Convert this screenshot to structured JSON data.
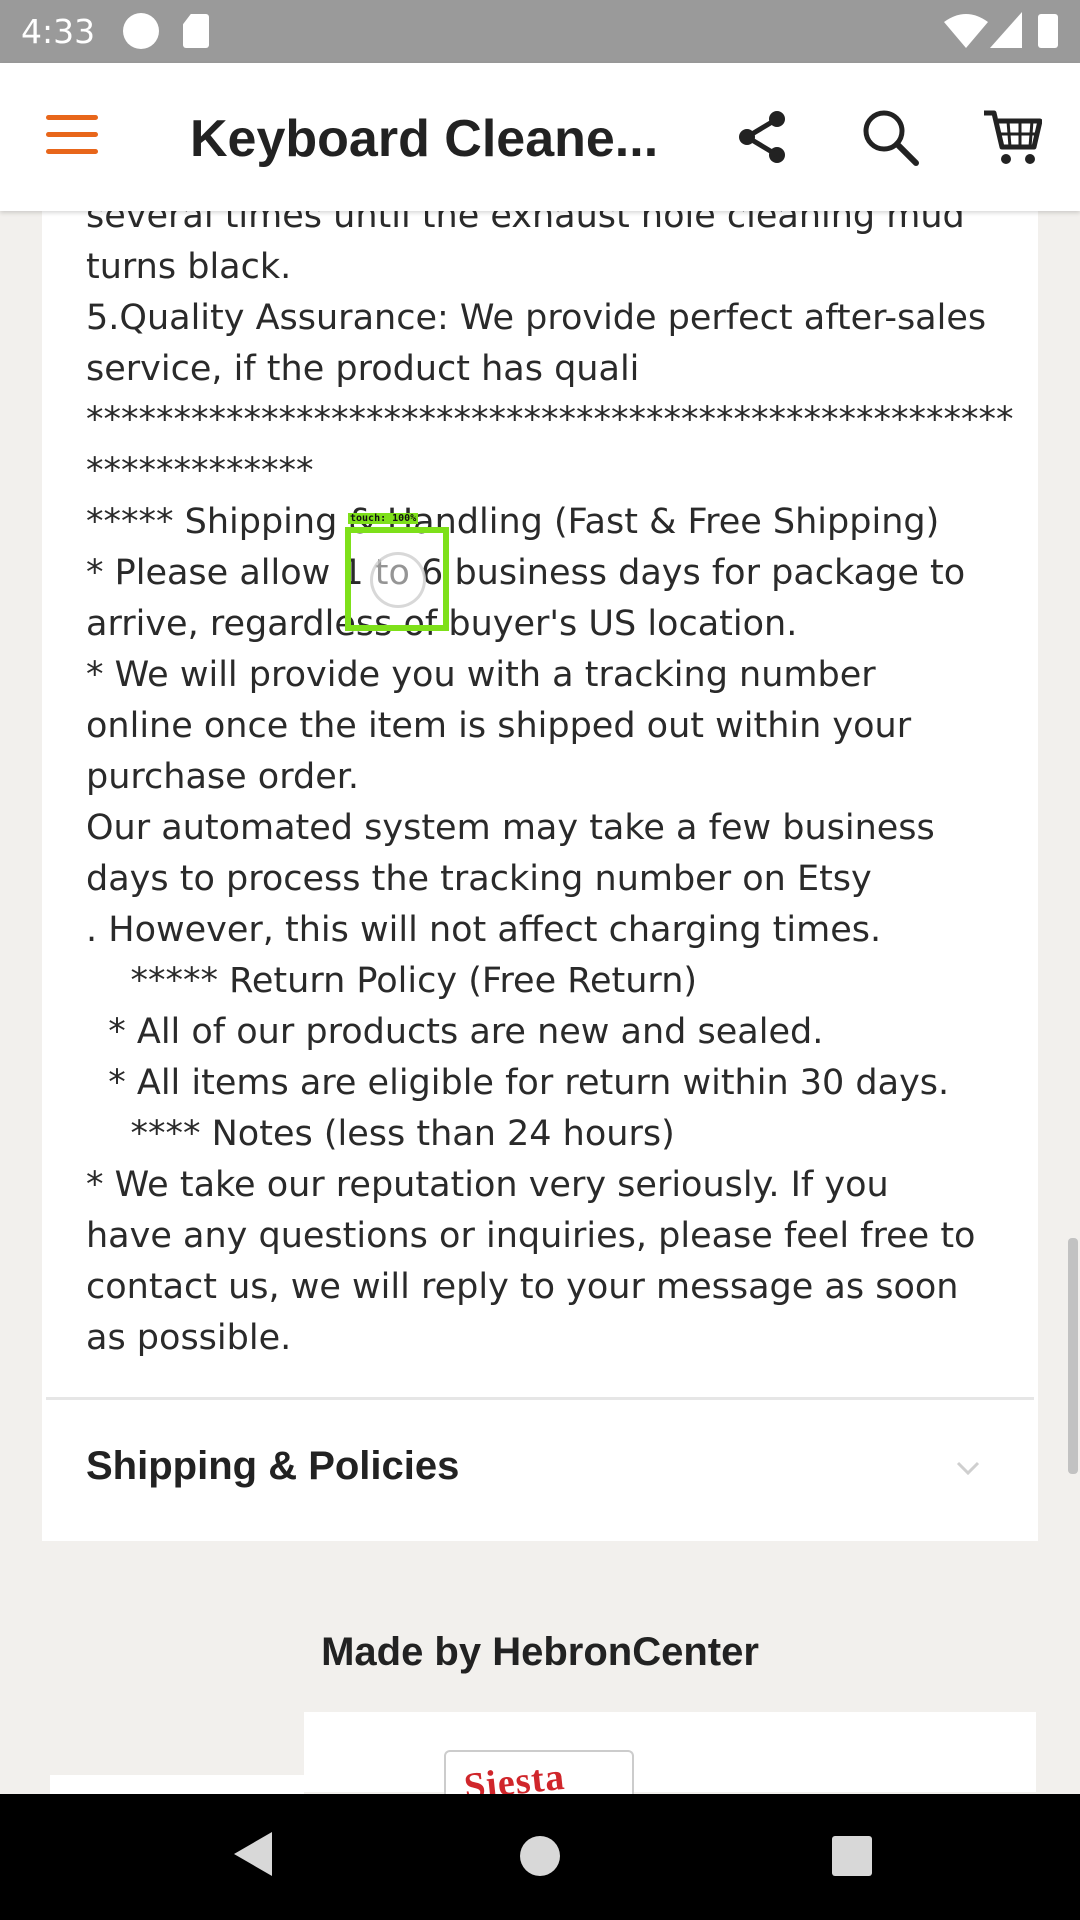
{
  "status_bar": {
    "time": "4:33",
    "icons": [
      "circle-status-icon",
      "sd-card-icon",
      "wifi-icon",
      "signal-icon",
      "battery-icon"
    ]
  },
  "app_bar": {
    "title": "Keyboard Cleane...",
    "icons": [
      "menu-icon",
      "share-icon",
      "search-icon",
      "cart-icon"
    ],
    "accent_color": "#e8661a"
  },
  "description": {
    "lines": [
      "several times until the exhaust hole cleaning mud",
      "turns black.",
      "5.Quality Assurance: We provide perfect after-sales",
      "service, if the product has quali",
      "*****************************************************",
      "*************",
      "***** Shipping & Handling (Fast & Free Shipping)",
      "* Please allow 1 to 6 business days for package to",
      "arrive, regardless of buyer's US location.",
      "* We will provide you with a tracking number",
      "online once the item is shipped out within your",
      "purchase order.",
      "Our automated system may take a few business",
      "days to process the tracking number on Etsy",
      ". However, this will not affect charging times.",
      "    ***** Return Policy (Free Return)",
      "  * All of our products are new and sealed.",
      "  * All items are eligible for return within 30 days.",
      "    **** Notes (less than 24 hours)",
      "* We take our reputation very seriously. If you",
      "have any questions or inquiries, please feel free to",
      "contact us, we will reply to your message as soon",
      "as possible."
    ]
  },
  "shipping_section": {
    "label": "Shipping & Policies",
    "icon": "chevron-down-icon"
  },
  "made_by": {
    "label": "Made by HebronCenter"
  },
  "shop_logo": {
    "text": "Siesta"
  },
  "touch_indicator": {
    "label": "touch: 100%",
    "color": "#7ee01a"
  },
  "nav_bar": {
    "buttons": [
      "back-icon",
      "home-icon",
      "recents-icon"
    ]
  }
}
